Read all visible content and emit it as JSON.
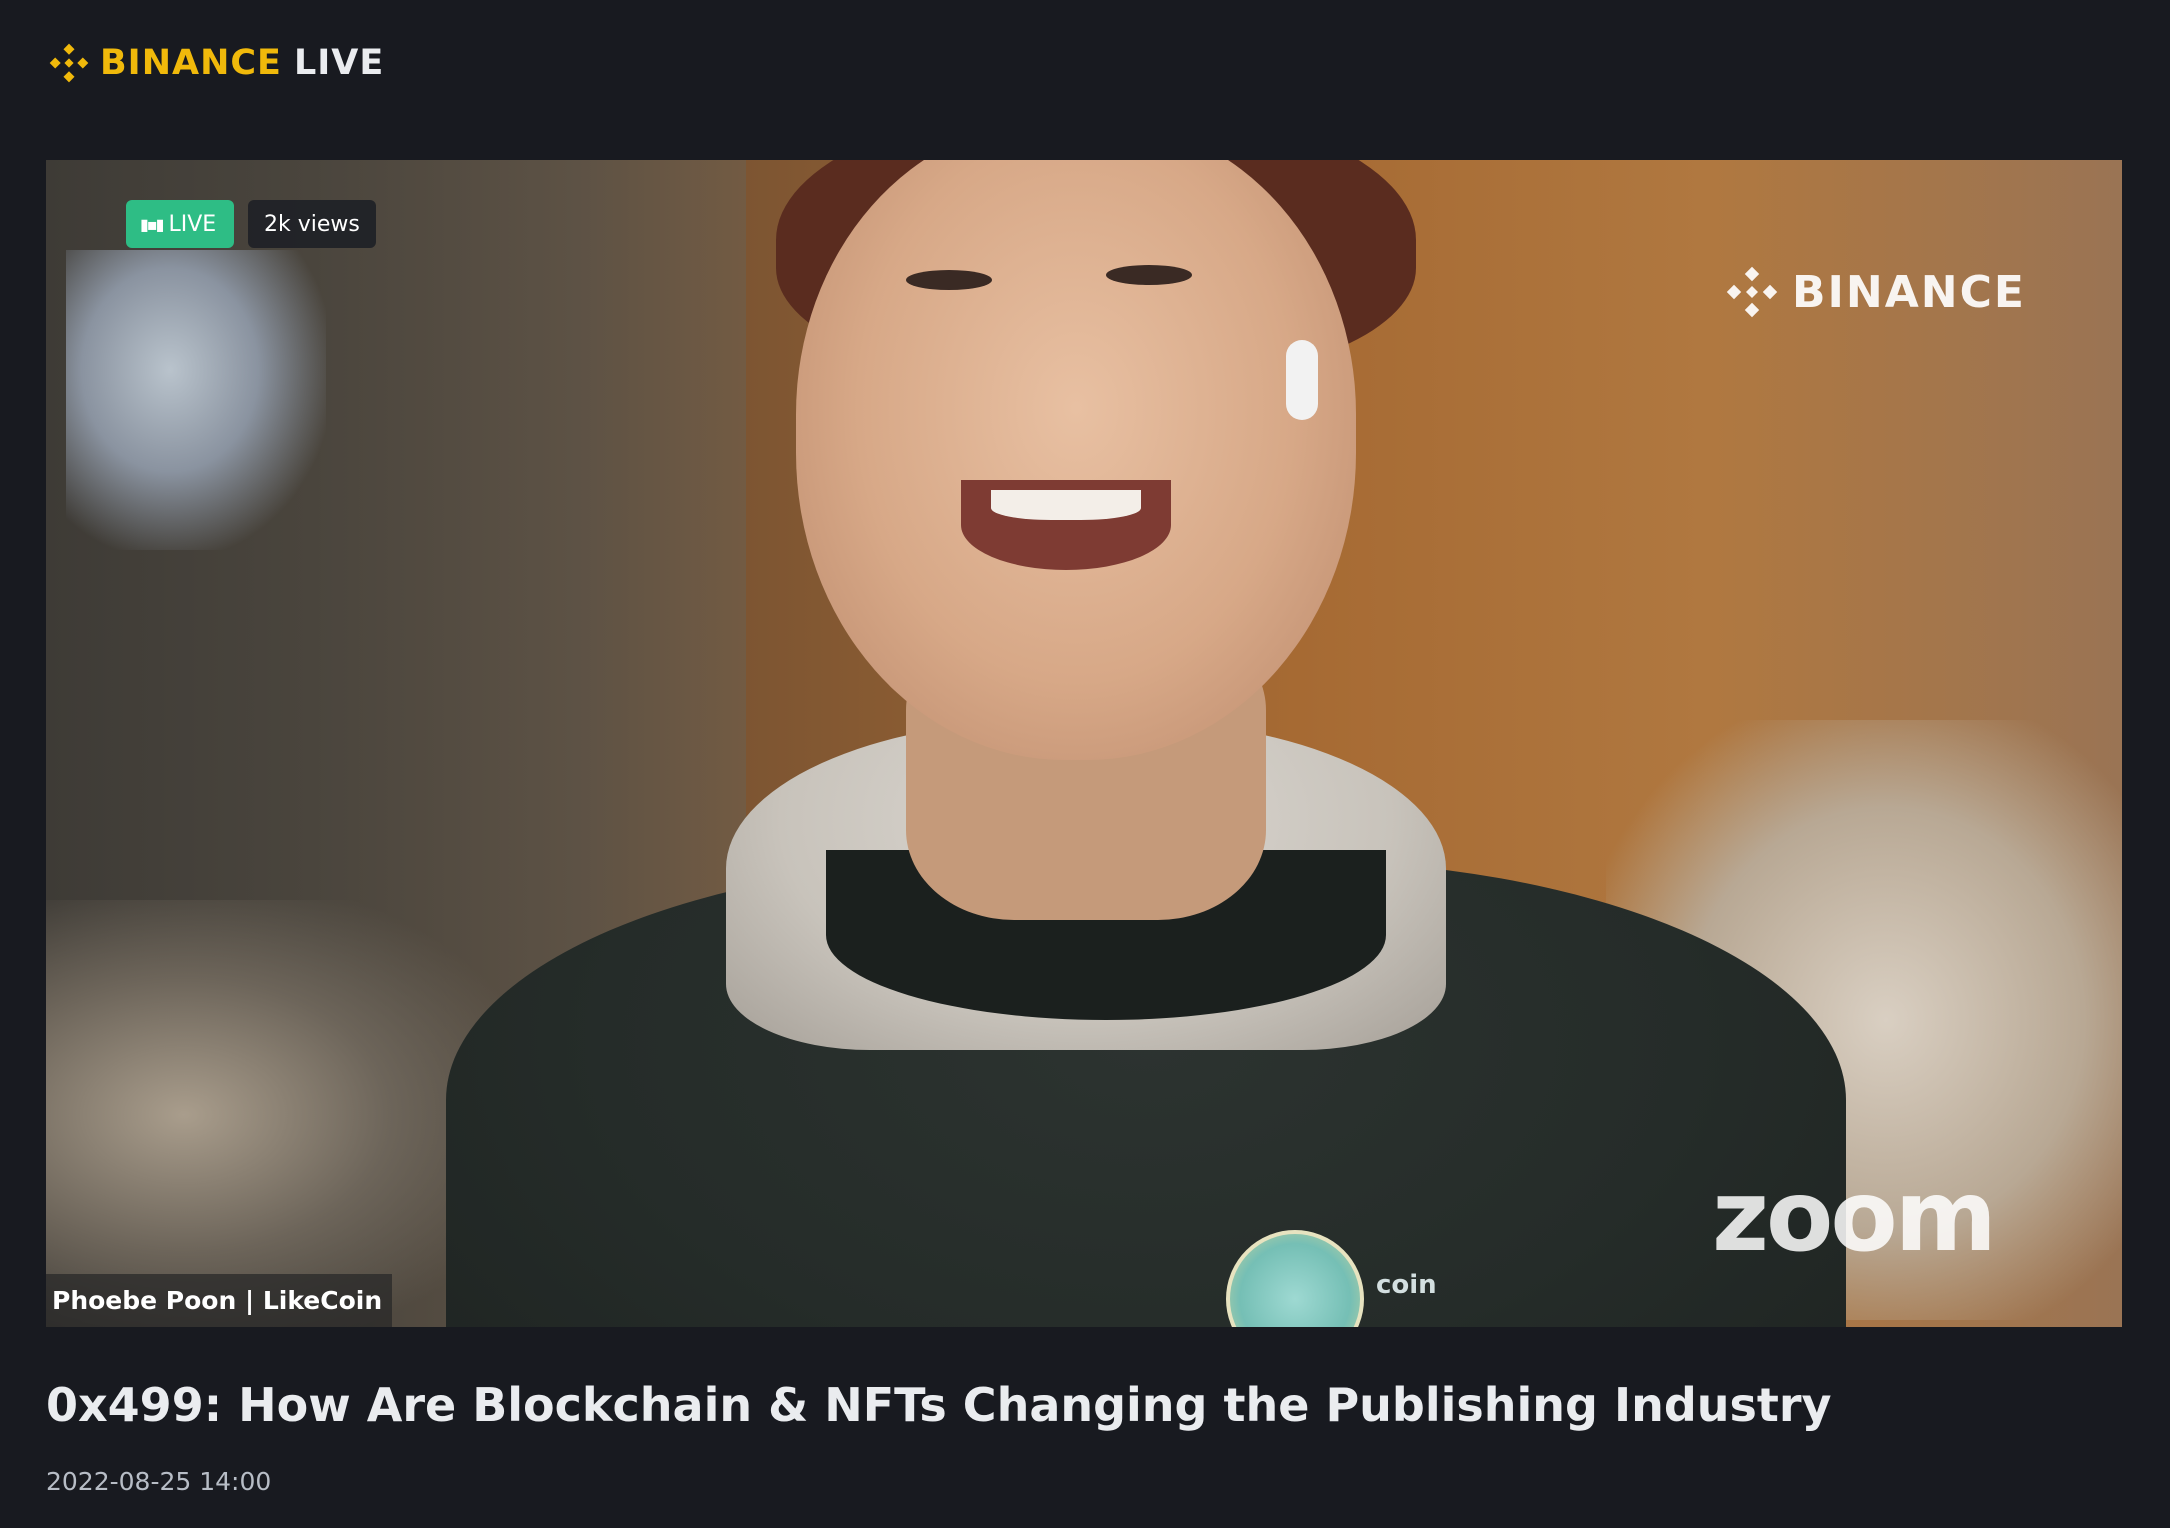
{
  "header": {
    "brand_primary": "BINANCE",
    "brand_secondary": "LIVE",
    "logo_icon": "binance-diamond-icon",
    "brand_color": "#f0b90b"
  },
  "video": {
    "live_label": "LIVE",
    "live_color": "#2ebd85",
    "views_label": "2k views",
    "watermark_binance": "BINANCE",
    "watermark_zoom": "zoom",
    "speaker_label": "Phoebe Poon | LikeCoin",
    "shirt_text": "coin"
  },
  "stream": {
    "title": "0x499: How Are Blockchain & NFTs Changing the Publishing Industry",
    "datetime": "2022-08-25 14:00"
  }
}
